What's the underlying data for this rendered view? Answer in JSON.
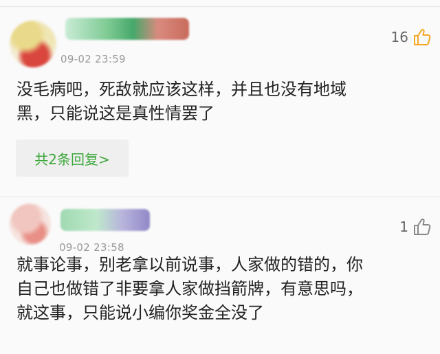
{
  "comments": [
    {
      "time": "09-02 23:59",
      "likes": "16",
      "like_icon": "thumbs-up-icon",
      "like_color": "#f5a623",
      "text": "没毛病吧，死敌就应该这样，并且也没有地域\n黑，只能说这是真性情罢了",
      "reply_label": "共2条回复>"
    },
    {
      "time": "09-02 23:58",
      "likes": "1",
      "like_icon": "thumbs-up-icon",
      "like_color": "#888888",
      "text": "就事论事，别老拿以前说事，人家做的错的，你\n自己也做错了非要拿人家做挡箭牌，有意思吗，\n就这事，只能说小编你奖金全没了"
    }
  ],
  "colors": {
    "reply_text": "#3da83b",
    "body_text": "#222222",
    "meta_text": "#999999"
  }
}
